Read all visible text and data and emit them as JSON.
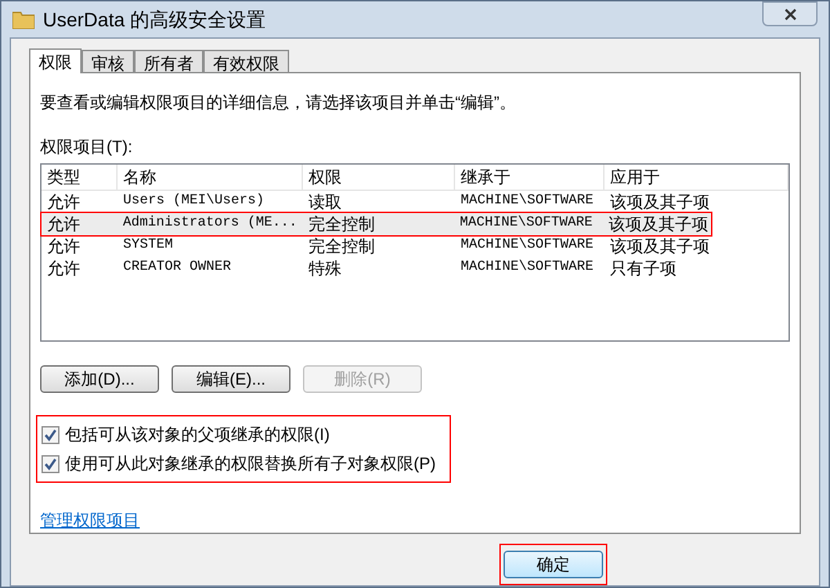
{
  "window": {
    "title": "UserData 的高级安全设置"
  },
  "tabs": [
    {
      "label": "权限",
      "selected": true
    },
    {
      "label": "审核",
      "selected": false
    },
    {
      "label": "所有者",
      "selected": false
    },
    {
      "label": "有效权限",
      "selected": false
    }
  ],
  "instruction": "要查看或编辑权限项目的详细信息，请选择该项目并单击“编辑”。",
  "list_label": "权限项目(T):",
  "table": {
    "columns": [
      "类型",
      "名称",
      "权限",
      "继承于",
      "应用于"
    ],
    "rows": [
      {
        "cells": [
          "允许",
          "Users (MEI\\Users)",
          "读取",
          "MACHINE\\SOFTWARE",
          "该项及其子项"
        ],
        "selected": false,
        "annotated": false
      },
      {
        "cells": [
          "允许",
          "Administrators (ME...",
          "完全控制",
          "MACHINE\\SOFTWARE",
          "该项及其子项"
        ],
        "selected": true,
        "annotated": true
      },
      {
        "cells": [
          "允许",
          "SYSTEM",
          "完全控制",
          "MACHINE\\SOFTWARE",
          "该项及其子项"
        ],
        "selected": false,
        "annotated": false
      },
      {
        "cells": [
          "允许",
          "CREATOR OWNER",
          "特殊",
          "MACHINE\\SOFTWARE",
          "只有子项"
        ],
        "selected": false,
        "annotated": false
      }
    ]
  },
  "buttons": [
    {
      "label": "添加(D)...",
      "disabled": false
    },
    {
      "label": "编辑(E)...",
      "disabled": false
    },
    {
      "label": "删除(R)",
      "disabled": true
    }
  ],
  "checkboxes_annotated": true,
  "checkboxes": [
    {
      "label": "包括可从该对象的父项继承的权限(I)",
      "checked": true
    },
    {
      "label": "使用可从此对象继承的权限替换所有子对象权限(P)",
      "checked": true
    }
  ],
  "link": "管理权限项目",
  "ok_button": {
    "label": "确定",
    "annotated": true
  }
}
